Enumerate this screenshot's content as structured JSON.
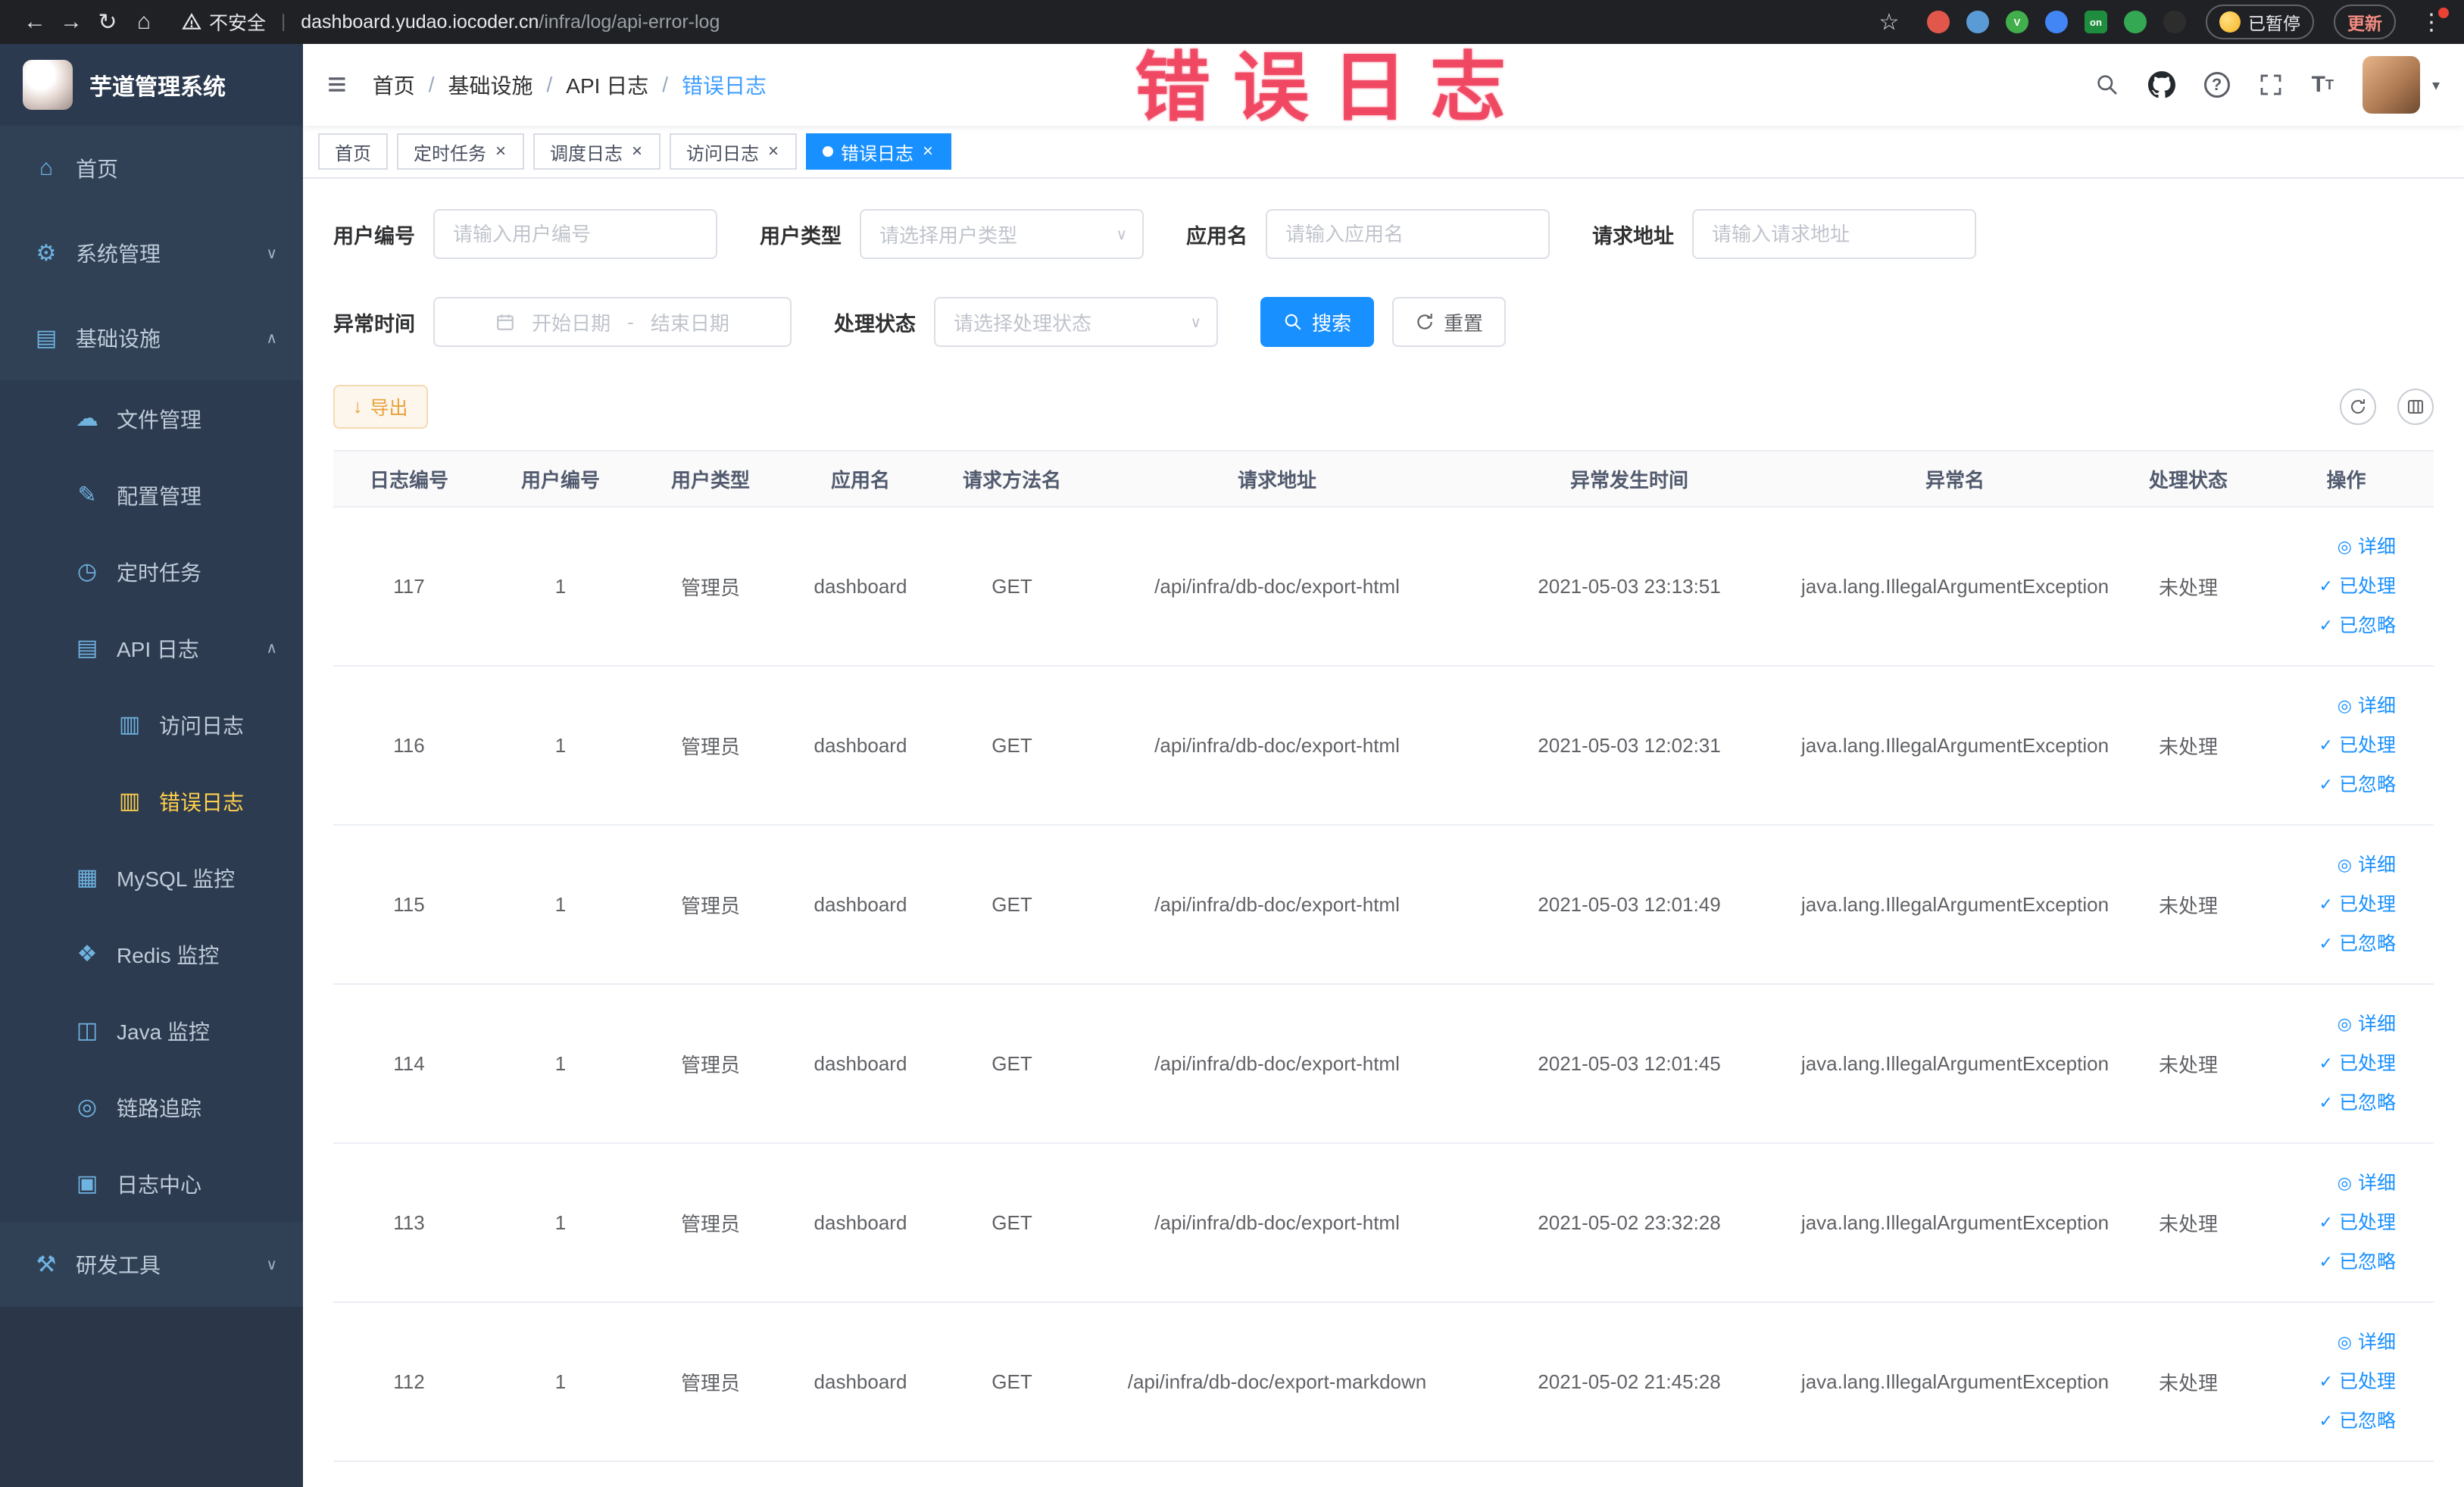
{
  "annotation": {
    "text": "错误日志"
  },
  "browser": {
    "security_label": "不安全",
    "url_domain": "dashboard.yudao.iocoder.cn",
    "url_path": "/infra/log/api-error-log",
    "paused_badge": "已暂停",
    "update_label": "更新",
    "extensions": [
      {
        "name": "extension-red-icon",
        "color": "#e2574c",
        "label": ""
      },
      {
        "name": "extension-blue-icon",
        "color": "#5b9bd5",
        "label": ""
      },
      {
        "name": "extension-green-v-icon",
        "color": "#41af4b",
        "label": "V"
      },
      {
        "name": "extension-grid-icon",
        "color": "#4285f4",
        "label": ""
      },
      {
        "name": "extension-on-icon",
        "color": "#1e8e3e",
        "label": "on",
        "square": true
      },
      {
        "name": "extension-leaf-icon",
        "color": "#34a853",
        "label": ""
      },
      {
        "name": "extension-pin-icon",
        "color": "#2d2d2d",
        "label": ""
      }
    ]
  },
  "sidebar": {
    "logo_title": "芋道管理系统",
    "items": [
      {
        "label": "首页",
        "icon": "home-icon",
        "glyph": "⌂",
        "level": 1
      },
      {
        "label": "系统管理",
        "icon": "system-management-icon",
        "glyph": "⚙",
        "level": 1,
        "arrow": "down"
      },
      {
        "label": "基础设施",
        "icon": "infrastructure-icon",
        "glyph": "▤",
        "level": 1,
        "arrow": "up"
      },
      {
        "label": "文件管理",
        "icon": "file-management-icon",
        "glyph": "☁",
        "level": 2
      },
      {
        "label": "配置管理",
        "icon": "config-management-icon",
        "glyph": "✎",
        "level": 2
      },
      {
        "label": "定时任务",
        "icon": "scheduled-job-icon",
        "glyph": "◷",
        "level": 2
      },
      {
        "label": "API 日志",
        "icon": "api-log-icon",
        "glyph": "▤",
        "level": 2,
        "arrow": "up"
      },
      {
        "label": "访问日志",
        "icon": "access-log-icon",
        "glyph": "▥",
        "level": 3
      },
      {
        "label": "错误日志",
        "icon": "error-log-icon",
        "glyph": "▥",
        "level": 3,
        "active": true
      },
      {
        "label": "MySQL 监控",
        "icon": "mysql-monitor-icon",
        "glyph": "▦",
        "level": 2
      },
      {
        "label": "Redis 监控",
        "icon": "redis-monitor-icon",
        "glyph": "❖",
        "level": 2
      },
      {
        "label": "Java 监控",
        "icon": "java-monitor-icon",
        "glyph": "◫",
        "level": 2
      },
      {
        "label": "链路追踪",
        "icon": "trace-icon",
        "glyph": "◎",
        "level": 2
      },
      {
        "label": "日志中心",
        "icon": "log-center-icon",
        "glyph": "▣",
        "level": 2
      },
      {
        "label": "研发工具",
        "icon": "dev-tools-icon",
        "glyph": "⚒",
        "level": 1,
        "arrow": "down"
      }
    ]
  },
  "navbar": {
    "breadcrumb": [
      "首页",
      "基础设施",
      "API 日志",
      "错误日志"
    ]
  },
  "tabs": [
    {
      "label": "首页",
      "closable": false,
      "active": false
    },
    {
      "label": "定时任务",
      "closable": true,
      "active": false
    },
    {
      "label": "调度日志",
      "closable": true,
      "active": false
    },
    {
      "label": "访问日志",
      "closable": true,
      "active": false
    },
    {
      "label": "错误日志",
      "closable": true,
      "active": true
    }
  ],
  "filters": {
    "user_id": {
      "label": "用户编号",
      "placeholder": "请输入用户编号"
    },
    "user_type": {
      "label": "用户类型",
      "placeholder": "请选择用户类型"
    },
    "app_name": {
      "label": "应用名",
      "placeholder": "请输入应用名"
    },
    "request_url": {
      "label": "请求地址",
      "placeholder": "请输入请求地址"
    },
    "exception_time": {
      "label": "异常时间",
      "start_placeholder": "开始日期",
      "separator": "-",
      "end_placeholder": "结束日期"
    },
    "process_status": {
      "label": "处理状态",
      "placeholder": "请选择处理状态"
    },
    "search_label": "搜索",
    "reset_label": "重置"
  },
  "toolbar": {
    "export_label": "导出"
  },
  "table": {
    "columns": [
      "日志编号",
      "用户编号",
      "用户类型",
      "应用名",
      "请求方法名",
      "请求地址",
      "异常发生时间",
      "异常名",
      "处理状态",
      "操作"
    ],
    "row_actions": [
      "详细",
      "已处理",
      "已忽略"
    ],
    "rows": [
      {
        "id": "117",
        "user_id": "1",
        "user_type": "管理员",
        "app": "dashboard",
        "method": "GET",
        "url": "/api/infra/db-doc/export-html",
        "time": "2021-05-03 23:13:51",
        "exception": "java.lang.IllegalArgumentException",
        "status": "未处理"
      },
      {
        "id": "116",
        "user_id": "1",
        "user_type": "管理员",
        "app": "dashboard",
        "method": "GET",
        "url": "/api/infra/db-doc/export-html",
        "time": "2021-05-03 12:02:31",
        "exception": "java.lang.IllegalArgumentException",
        "status": "未处理"
      },
      {
        "id": "115",
        "user_id": "1",
        "user_type": "管理员",
        "app": "dashboard",
        "method": "GET",
        "url": "/api/infra/db-doc/export-html",
        "time": "2021-05-03 12:01:49",
        "exception": "java.lang.IllegalArgumentException",
        "status": "未处理"
      },
      {
        "id": "114",
        "user_id": "1",
        "user_type": "管理员",
        "app": "dashboard",
        "method": "GET",
        "url": "/api/infra/db-doc/export-html",
        "time": "2021-05-03 12:01:45",
        "exception": "java.lang.IllegalArgumentException",
        "status": "未处理"
      },
      {
        "id": "113",
        "user_id": "1",
        "user_type": "管理员",
        "app": "dashboard",
        "method": "GET",
        "url": "/api/infra/db-doc/export-html",
        "time": "2021-05-02 23:32:28",
        "exception": "java.lang.IllegalArgumentException",
        "status": "未处理"
      },
      {
        "id": "112",
        "user_id": "1",
        "user_type": "管理员",
        "app": "dashboard",
        "method": "GET",
        "url": "/api/infra/db-doc/export-markdown",
        "time": "2021-05-02 21:45:28",
        "exception": "java.lang.IllegalArgumentException",
        "status": "未处理"
      }
    ]
  },
  "colors": {
    "accent": "#1890ff",
    "active_tab": "#1890ff",
    "menu_active": "#ffd04b",
    "warning": "#e6a23c",
    "annotation": "#ef3e5a"
  }
}
